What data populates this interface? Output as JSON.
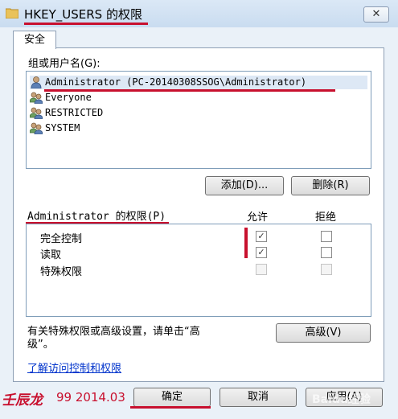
{
  "window": {
    "title": "HKEY_USERS 的权限",
    "close_glyph": "✕"
  },
  "tab": {
    "label": "安全"
  },
  "users": {
    "label": "组或用户名(G):",
    "items": [
      {
        "name": "Administrator (PC-20140308SSOG\\Administrator)",
        "selected": true
      },
      {
        "name": "Everyone",
        "selected": false
      },
      {
        "name": "RESTRICTED",
        "selected": false
      },
      {
        "name": "SYSTEM",
        "selected": false
      }
    ],
    "add_button": "添加(D)...",
    "remove_button": "删除(R)"
  },
  "permissions": {
    "label": "Administrator 的权限(P)",
    "allow_header": "允许",
    "deny_header": "拒绝",
    "rows": [
      {
        "name": "完全控制",
        "allow": true,
        "deny": false,
        "disabled": false
      },
      {
        "name": "读取",
        "allow": true,
        "deny": false,
        "disabled": false
      },
      {
        "name": "特殊权限",
        "allow": false,
        "deny": false,
        "disabled": true
      }
    ],
    "check_glyph": "✓"
  },
  "advanced": {
    "text_line1": "有关特殊权限或高级设置，请单击“高",
    "text_line2": "级”。",
    "button": "高级(V)"
  },
  "help_link": "了解访问控制和权限",
  "footer": {
    "ok": "确定",
    "cancel": "取消",
    "apply": "应用(A)"
  },
  "watermark": {
    "signature": "壬辰龙",
    "date": "99 2014.03",
    "brand": "Baidu经验"
  },
  "colors": {
    "annotation": "#c8102e",
    "link": "#0033cc",
    "selection": "#dde8f5"
  }
}
